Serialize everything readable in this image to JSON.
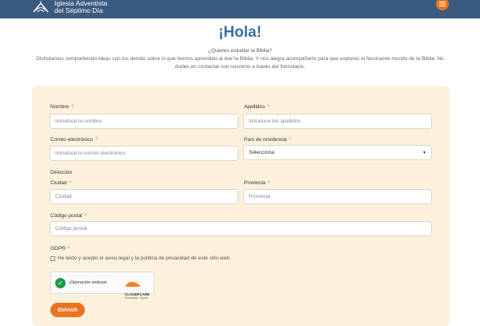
{
  "header": {
    "logo_line1": "Iglesia Adventista",
    "logo_line2": "del Séptimo Día",
    "menu_icon": "menu-icon"
  },
  "page": {
    "title": "¡Hola!",
    "question": "¿Quieres estudiar la Biblia?",
    "intro": "Disfrutamos compartiendo ideas con los demás sobre lo que hemos aprendido al leer la Biblia. Y nos alegra acompañarte para que explores el fascinante mundo de la Biblia. No dudes en contactar con nosotros a través del formulario."
  },
  "form": {
    "nombre": {
      "label": "Nombre",
      "placeholder": "Introduce tu nombre"
    },
    "apellidos": {
      "label": "Apellidos",
      "placeholder": "Introduce tus apellidos"
    },
    "email": {
      "label": "Correo electrónico",
      "placeholder": "Introduce tu correo electrónico"
    },
    "pais": {
      "label": "País de residencia",
      "value": "Selecciona"
    },
    "direccion_label": "Dirección",
    "ciudad": {
      "label": "Ciudad",
      "placeholder": "Ciudad"
    },
    "provincia": {
      "label": "Provincia",
      "placeholder": "Provincia"
    },
    "codigo_postal": {
      "label": "Código postal",
      "placeholder": "Código postal"
    },
    "gdpr": {
      "label": "GDPR",
      "checkbox_text": "He leído y acepto el aviso legal y la política de privacidad de este sitio web."
    },
    "required_mark": "*",
    "submit_label": "ENVIAR"
  },
  "captcha": {
    "status": "¡Operación exitosa!",
    "brand": "CLOUDFLARE",
    "links": "Privacidad · Ayuda"
  },
  "colors": {
    "header_bg": "#3b5a80",
    "accent": "#e8741e",
    "title": "#3b6fa0",
    "form_bg": "#fbf1dc",
    "success": "#1e9b46"
  }
}
